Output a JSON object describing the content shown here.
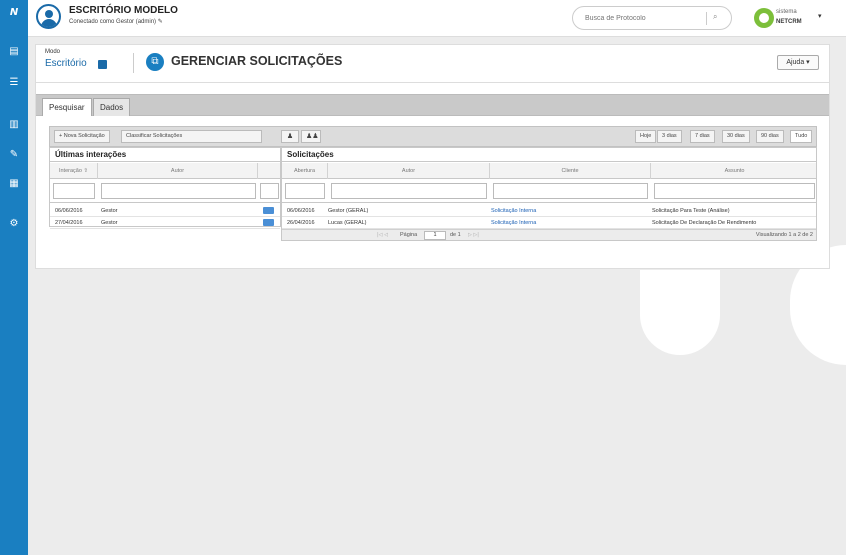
{
  "sidebar": {
    "icons": [
      "logo-icon",
      "document-icon",
      "list-icon",
      "chart-icon",
      "edit-icon",
      "calendar-icon",
      "settings-icon"
    ]
  },
  "header": {
    "company": "ESCRITÓRIO MODELO",
    "connected": "Conectado como Gestor (admin) ✎",
    "search_placeholder": "Busca de Protocolo",
    "brand_small": "sistema",
    "brand": "NETCRM"
  },
  "panel": {
    "mode_label": "Modo",
    "mode_value": "Escritório",
    "title": "GERENCIAR SOLICITAÇÕES",
    "help": "Ajuda ▾"
  },
  "tabs": [
    {
      "label": "Pesquisar",
      "active": true
    },
    {
      "label": "Dados",
      "active": false
    }
  ],
  "toolbar": {
    "new_request": "+ Nova Solicitação",
    "classify": "Classificar Solicitações",
    "filters": [
      "Hoje",
      "3 dias",
      "7 dias",
      "30 dias",
      "90 dias",
      "Tudo"
    ],
    "active_filter": "Tudo"
  },
  "interactions": {
    "title": "Últimas interações",
    "columns": [
      "Interação ⇧",
      "Autor",
      ""
    ],
    "rows": [
      {
        "date": "06/06/2016",
        "author": "Gestor"
      },
      {
        "date": "27/04/2016",
        "author": "Gestor"
      }
    ]
  },
  "requests": {
    "title": "Solicitações",
    "columns": [
      "Abertura",
      "Autor",
      "Cliente",
      "Assunto"
    ],
    "rows": [
      {
        "date": "06/06/2016",
        "author": "Gestor (GERAL)",
        "client": "Solicitação Interna",
        "subject": "Solicitação Para Teste (Análise)"
      },
      {
        "date": "26/04/2016",
        "author": "Lucas (GERAL)",
        "client": "Solicitação Interna",
        "subject": "Solicitação De Declaração De Rendimento"
      }
    ],
    "pager": {
      "first_prev": "|◁ ◁",
      "page_label": "Página",
      "page_value": "1",
      "of_label": "de 1",
      "next_last": "▷ ▷|",
      "showing": "Visualizando 1 a 2 de 2"
    }
  },
  "colors": {
    "sidebar": "#1a7fc1",
    "accent": "#1a6aa8",
    "link": "#1a5fb4",
    "brand_green": "#7cbf3a"
  }
}
